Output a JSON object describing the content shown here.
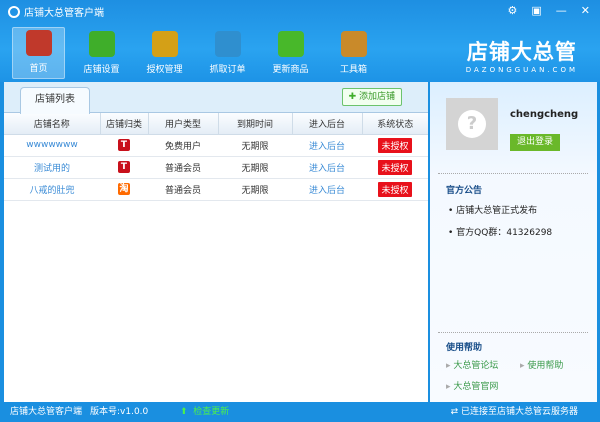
{
  "app": {
    "title": "店铺大总管客户端"
  },
  "toolbar": [
    {
      "label": "首页",
      "icon": "home-icon",
      "color": "#c0392b"
    },
    {
      "label": "店铺设置",
      "icon": "gear-icon",
      "color": "#3fae2a"
    },
    {
      "label": "授权管理",
      "icon": "lock-key-icon",
      "color": "#d4a017"
    },
    {
      "label": "抓取订单",
      "icon": "orders-icon",
      "color": "#2f8fcf"
    },
    {
      "label": "更新商品",
      "icon": "up-arrow-icon",
      "color": "#48b82a"
    },
    {
      "label": "工具箱",
      "icon": "toolbox-icon",
      "color": "#c98a2a"
    }
  ],
  "brand": {
    "name": "店铺大总管",
    "domain": "DAZONGGUAN.COM"
  },
  "panel": {
    "tab": "店铺列表",
    "add_button": "添加店铺"
  },
  "table": {
    "headers": [
      "店铺名称",
      "店铺归类",
      "用户类型",
      "到期时间",
      "进入后台",
      "系统状态"
    ],
    "rows": [
      {
        "name": "wwwwwww",
        "category": "T",
        "user_type": "免费用户",
        "expiry": "无期限",
        "enter": "进入后台",
        "status": "未授权"
      },
      {
        "name": "测试用的",
        "category": "T",
        "user_type": "普通会员",
        "expiry": "无期限",
        "enter": "进入后台",
        "status": "未授权"
      },
      {
        "name": "八戒的肚兜",
        "category": "淘",
        "user_type": "普通会员",
        "expiry": "无期限",
        "enter": "进入后台",
        "status": "未授权"
      }
    ]
  },
  "user": {
    "name": "chengcheng",
    "logout": "退出登录"
  },
  "notice": {
    "title": "官方公告",
    "items": [
      "店铺大总管正式发布",
      "官方QQ群：41326298"
    ]
  },
  "help": {
    "title": "使用帮助",
    "links": [
      "大总管论坛",
      "使用帮助",
      "大总管官网"
    ]
  },
  "statusbar": {
    "app": "店铺大总管客户端",
    "version": "版本号:v1.0.0",
    "update": "检查更新",
    "connection": "已连接至店铺大总管云服务器"
  }
}
